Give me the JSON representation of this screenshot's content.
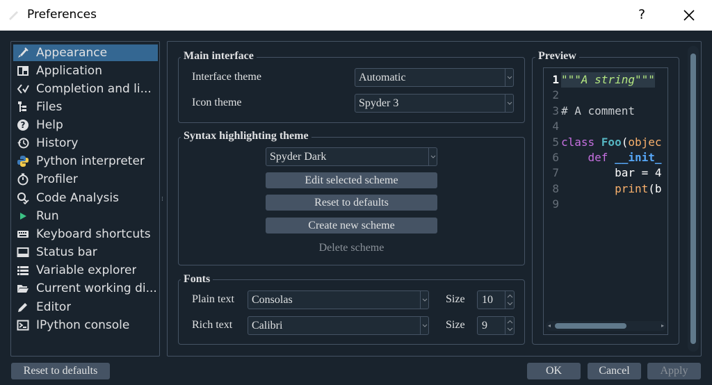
{
  "window": {
    "title": "Preferences",
    "help_glyph": "?",
    "close_glyph": "✕"
  },
  "nav": {
    "items": [
      {
        "label": "Appearance",
        "icon": "paintbrush-icon",
        "selected": true
      },
      {
        "label": "Application",
        "icon": "window-layout-icon"
      },
      {
        "label": "Completion and li...",
        "icon": "completion-icon"
      },
      {
        "label": "Files",
        "icon": "file-tree-icon"
      },
      {
        "label": "Help",
        "icon": "help-circle-icon"
      },
      {
        "label": "History",
        "icon": "history-icon"
      },
      {
        "label": "Python interpreter",
        "icon": "python-icon"
      },
      {
        "label": "Profiler",
        "icon": "stopwatch-icon"
      },
      {
        "label": "Code Analysis",
        "icon": "code-analysis-icon"
      },
      {
        "label": "Run",
        "icon": "play-icon"
      },
      {
        "label": "Keyboard shortcuts",
        "icon": "keyboard-icon"
      },
      {
        "label": "Status bar",
        "icon": "statusbar-icon"
      },
      {
        "label": "Variable explorer",
        "icon": "list-icon"
      },
      {
        "label": "Current working di...",
        "icon": "folder-open-icon"
      },
      {
        "label": "Editor",
        "icon": "pencil-icon"
      },
      {
        "label": "IPython console",
        "icon": "console-icon"
      }
    ]
  },
  "main_interface": {
    "title": "Main interface",
    "interface_theme_label": "Interface theme",
    "interface_theme_value": "Automatic",
    "icon_theme_label": "Icon theme",
    "icon_theme_value": "Spyder 3"
  },
  "syntax": {
    "title": "Syntax highlighting theme",
    "scheme_value": "Spyder Dark",
    "edit_label": "Edit selected scheme",
    "reset_label": "Reset to defaults",
    "create_label": "Create new scheme",
    "delete_label": "Delete scheme"
  },
  "fonts": {
    "title": "Fonts",
    "plain_label": "Plain text",
    "plain_value": "Consolas",
    "plain_size_label": "Size",
    "plain_size": "10",
    "rich_label": "Rich text",
    "rich_value": "Calibri",
    "rich_size_label": "Size",
    "rich_size": "9"
  },
  "preview": {
    "title": "Preview",
    "line_numbers": [
      "1",
      "2",
      "3",
      "4",
      "5",
      "6",
      "7",
      "8",
      "9"
    ],
    "lines": [
      [
        {
          "t": "\"\"\"A string\"\"\"",
          "c": "#b4e780",
          "i": true
        }
      ],
      [],
      [
        {
          "t": "# A comment",
          "c": "#c9cdd1"
        }
      ],
      [],
      [
        {
          "t": "class ",
          "c": "#c670e0"
        },
        {
          "t": "Foo",
          "c": "#56b6c2",
          "b": true
        },
        {
          "t": "(",
          "c": "#ffffff"
        },
        {
          "t": "objec",
          "c": "#fab16c"
        }
      ],
      [
        {
          "t": "    def ",
          "c": "#c670e0"
        },
        {
          "t": "__init_",
          "c": "#57a7f7",
          "b": true
        }
      ],
      [
        {
          "t": "        bar = 4",
          "c": "#ffffff"
        }
      ],
      [
        {
          "t": "        ",
          "c": "#ffffff"
        },
        {
          "t": "print",
          "c": "#fab16c"
        },
        {
          "t": "(b",
          "c": "#ffffff"
        }
      ],
      []
    ]
  },
  "footer": {
    "reset_label": "Reset to defaults",
    "ok_label": "OK",
    "cancel_label": "Cancel",
    "apply_label": "Apply"
  },
  "colors": {
    "background": "#19232d",
    "selection": "#346792",
    "border": "#455364",
    "button": "#455364"
  }
}
